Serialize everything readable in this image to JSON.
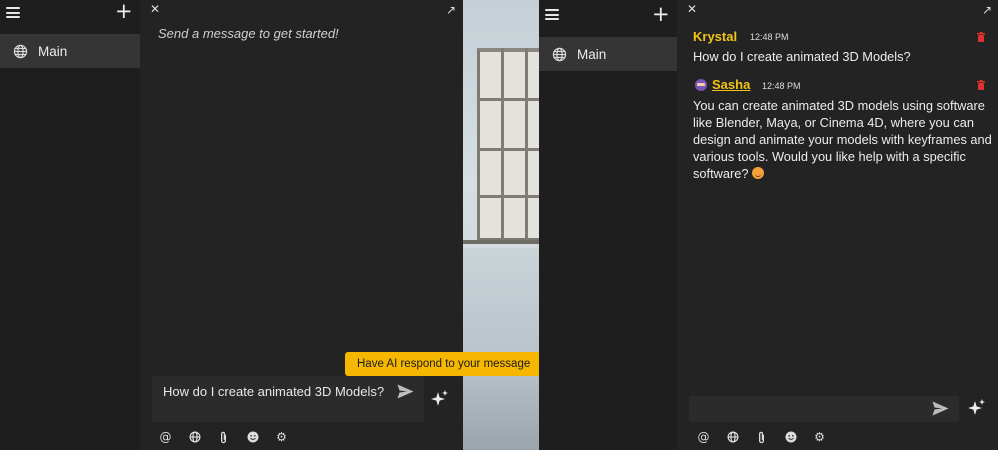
{
  "left_panel": {
    "sidebar": {
      "menu_icon": "hamburger-icon",
      "add_icon": "plus-icon",
      "channels": [
        {
          "label": "Main",
          "icon": "globe-icon"
        }
      ]
    },
    "chat": {
      "close_label": "✕",
      "popout_label": "↗",
      "empty_text": "Send a message to get started!",
      "composer_text": "How do I create animated 3D Models?",
      "toolbar": [
        "at-icon",
        "globe-icon",
        "paperclip-icon",
        "emoji-icon",
        "gear-icon"
      ]
    }
  },
  "tooltip": {
    "text": "Have AI respond to your message"
  },
  "right_panel": {
    "sidebar": {
      "menu_icon": "hamburger-icon",
      "add_icon": "plus-icon",
      "channels": [
        {
          "label": "Main",
          "icon": "globe-icon"
        }
      ]
    },
    "chat": {
      "close_label": "✕",
      "popout_label": "↗",
      "messages": [
        {
          "author": "Krystal",
          "time": "12:48 PM",
          "text": "How do I create animated 3D Models?"
        },
        {
          "author": "Sasha",
          "time": "12:48 PM",
          "text": "You can create animated 3D models using software like Blender, Maya, or Cinema 4D, where you can design and animate your models with keyframes and various tools. Would you like help with a specific software?"
        }
      ],
      "composer_text": "",
      "toolbar": [
        "at-icon",
        "globe-icon",
        "paperclip-icon",
        "emoji-icon",
        "gear-icon"
      ]
    }
  },
  "colors": {
    "accent": "#f5b700",
    "name": "#f2c318",
    "trash": "#e03030",
    "panel": "#232323",
    "sidebar": "#1e1e1e",
    "selected": "#353535"
  }
}
